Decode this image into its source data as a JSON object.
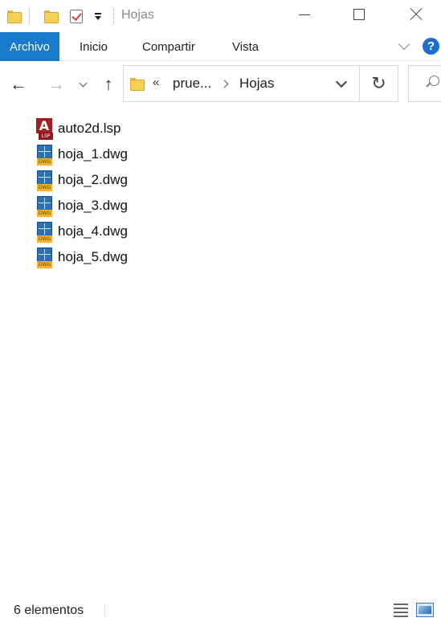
{
  "window": {
    "title": "Hojas"
  },
  "quick_access": {
    "icons": [
      "folder-icon",
      "folder-icon",
      "properties-check-icon",
      "customize-dropdown-icon"
    ]
  },
  "ribbon": {
    "tabs": [
      {
        "label": "Archivo",
        "active": true
      },
      {
        "label": "Inicio",
        "active": false
      },
      {
        "label": "Compartir",
        "active": false
      },
      {
        "label": "Vista",
        "active": false
      }
    ],
    "help_label": "?",
    "accent_color": "#1979ca"
  },
  "address": {
    "overflow_label": "«",
    "crumbs": [
      "prue...",
      "Hojas"
    ]
  },
  "files": [
    {
      "name": "auto2d.lsp",
      "icon": "lsp-file-icon"
    },
    {
      "name": "hoja_1.dwg",
      "icon": "dwg-file-icon"
    },
    {
      "name": "hoja_2.dwg",
      "icon": "dwg-file-icon"
    },
    {
      "name": "hoja_3.dwg",
      "icon": "dwg-file-icon"
    },
    {
      "name": "hoja_4.dwg",
      "icon": "dwg-file-icon"
    },
    {
      "name": "hoja_5.dwg",
      "icon": "dwg-file-icon"
    }
  ],
  "status": {
    "item_count": "6 elementos"
  }
}
